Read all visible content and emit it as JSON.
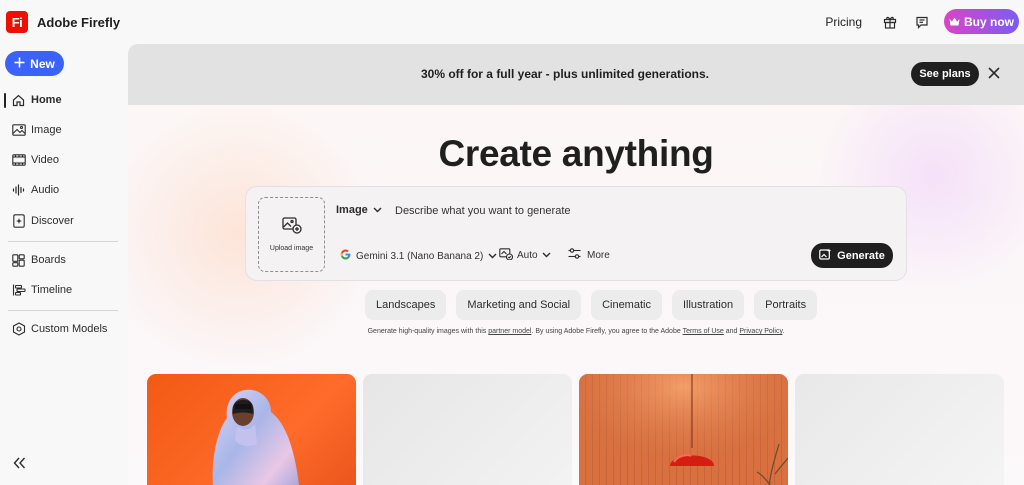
{
  "app": {
    "logo_text": "Fi",
    "title": "Adobe Firefly"
  },
  "topbar": {
    "pricing": "Pricing",
    "buy_now": "Buy now",
    "icons": [
      "gift-icon",
      "chat-icon",
      "crown-icon"
    ]
  },
  "sidebar": {
    "new_label": "New",
    "items": [
      {
        "label": "Home",
        "icon": "home-icon",
        "active": true
      },
      {
        "label": "Image",
        "icon": "image-icon"
      },
      {
        "label": "Video",
        "icon": "video-icon"
      },
      {
        "label": "Audio",
        "icon": "audio-icon"
      },
      {
        "label": "Discover",
        "icon": "discover-icon"
      },
      {
        "label": "Boards",
        "icon": "boards-icon"
      },
      {
        "label": "Timeline",
        "icon": "timeline-icon"
      },
      {
        "label": "Custom Models",
        "icon": "custom-models-icon"
      }
    ]
  },
  "promo": {
    "text": "30% off for a full year  - plus unlimited generations.",
    "button": "See plans"
  },
  "main": {
    "headline": "Create anything",
    "upload_label": "Upload image",
    "type_select": "Image",
    "prompt_placeholder": "Describe what you want to generate",
    "model": "Gemini 3.1 (Nano Banana 2)",
    "ratio": "Auto",
    "more": "More",
    "generate": "Generate",
    "chips": [
      "Landscapes",
      "Marketing and Social",
      "Cinematic",
      "Illustration",
      "Portraits"
    ],
    "legal": {
      "p1": "Generate high-quality images with this ",
      "link1": "partner model",
      "p2": ". By using Adobe Firefly, you agree to the Adobe ",
      "link2": "Terms of Use",
      "p3": " and ",
      "link3": "Privacy Policy",
      "p4": "."
    }
  },
  "colors": {
    "brand_red": "#eb1000",
    "new_button_blue": "#3b63fb",
    "dark_button": "#1f1f1f"
  }
}
